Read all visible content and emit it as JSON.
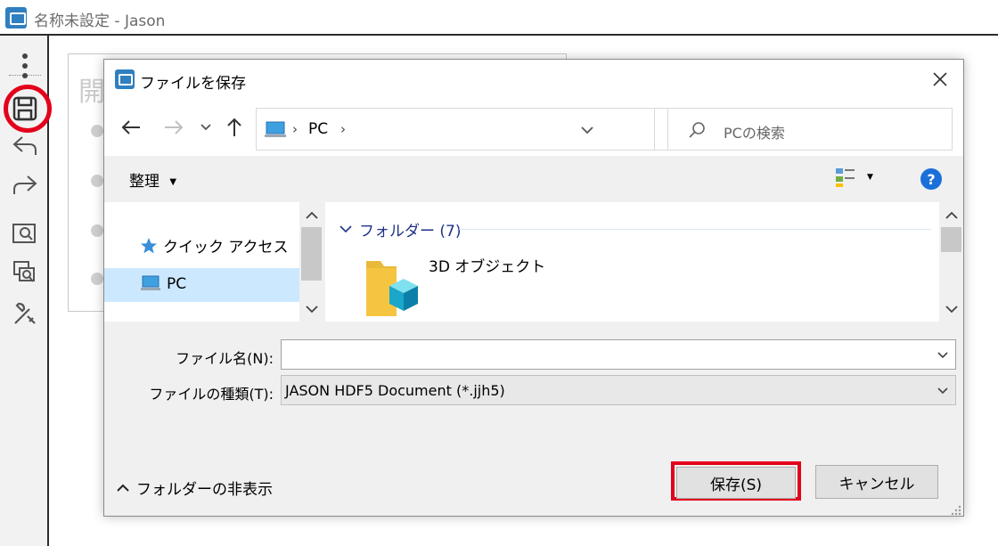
{
  "app": {
    "title": "名称未設定 - Jason",
    "content_heading_char": "開",
    "toolbar_icons": [
      "more-options-icon",
      "save-icon",
      "undo-icon",
      "redo-icon",
      "zoom-window-icon",
      "zoom-selection-icon",
      "tools-icon"
    ]
  },
  "dialog": {
    "title": "ファイルを保存",
    "address": {
      "path": "PC",
      "separator": "›"
    },
    "search": {
      "placeholder": "PCの検索"
    },
    "command_bar": {
      "organize_label": "整理"
    },
    "nav_pane": {
      "items": [
        {
          "label": "クイック アクセス",
          "icon": "star-icon"
        },
        {
          "label": "PC",
          "icon": "computer-icon",
          "selected": true
        }
      ]
    },
    "content": {
      "group_header": "フォルダー (7)",
      "items": [
        {
          "label": "3D オブジェクト",
          "icon": "3d-objects-folder-icon"
        }
      ]
    },
    "filename": {
      "label": "ファイル名(N):",
      "value": ""
    },
    "filetype": {
      "label": "ファイルの種類(T):",
      "value": "JASON HDF5 Document (*.jjh5)"
    },
    "hide_folders_label": "フォルダーの非表示",
    "save_label": "保存(S)",
    "cancel_label": "キャンセル"
  },
  "colors": {
    "highlight_red": "#e3001b",
    "accent_blue": "#1a6fd8",
    "folder_yellow": "#f5c542"
  }
}
